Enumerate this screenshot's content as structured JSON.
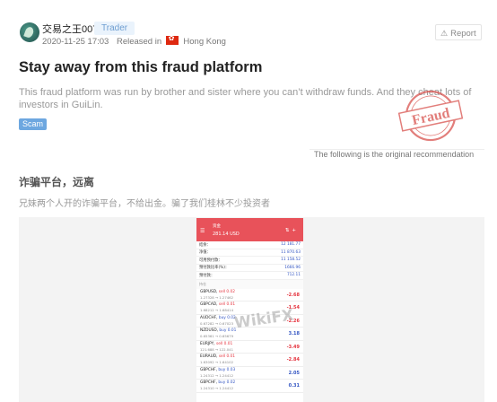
{
  "header": {
    "username": "交易之王007",
    "role": "Trader",
    "datetime": "2020-11-25 17:03",
    "released_label": "Released in",
    "country": "Hong Kong",
    "report_label": "Report"
  },
  "post": {
    "title": "Stay away from this fraud platform",
    "description": "This fraud platform was run by brother and sister where you can’t withdraw funds. And they cheat lots of investors in GuiLin.",
    "tag": "Scam",
    "stamp_text": "Fraud",
    "original_recommendation": "The following is the original recommendation",
    "original_title": "诈骗平台，远离",
    "original_desc": "兄妹两个人开的诈骗平台，不给出金。骗了我们桂林不少投资者"
  },
  "screenshot": {
    "watermark": "WikiFX",
    "menu_icon": "menu-icon",
    "account_label": "资金",
    "balance": "281.14 USD",
    "summary": [
      {
        "label": "结余：",
        "value": "12 181.77"
      },
      {
        "label": "净值：",
        "value": "11 870.63"
      },
      {
        "label": "可用预付款：",
        "value": "11 158.52"
      },
      {
        "label": "预付款比率(%)：",
        "value": "1666.96"
      },
      {
        "label": "预付款：",
        "value": "712.11"
      }
    ],
    "positions_section": "持仓",
    "positions": [
      {
        "symbol": "GBPUSD,",
        "side": "sell 0.02",
        "side_type": "sell",
        "prices": "1.27328 → 1.27462",
        "pl": "-2.68"
      },
      {
        "symbol": "GBPCAD,",
        "side": "sell 0.01",
        "side_type": "sell",
        "prices": "1.68212 → 1.68414",
        "pl": "-1.54"
      },
      {
        "symbol": "AUDCHF,",
        "side": "buy 0.02",
        "side_type": "buy",
        "prices": "0.67282 → 0.67023",
        "pl": "-2.26"
      },
      {
        "symbol": "NZDUSD,",
        "side": "buy 0.01",
        "side_type": "buy",
        "prices": "0.65361 → 0.65679",
        "pl": "3.18"
      },
      {
        "symbol": "EURJPY,",
        "side": "sell 0.01",
        "side_type": "sell",
        "prices": "121.688 → 122.041",
        "pl": "-3.49"
      },
      {
        "symbol": "EURAUD,",
        "side": "sell 0.01",
        "side_type": "sell",
        "prices": "1.63092 → 1.64102",
        "pl": "-2.84"
      },
      {
        "symbol": "GBPCHF,",
        "side": "buy 0.03",
        "side_type": "buy",
        "prices": "1.24312 → 1.24412",
        "pl": "2.05"
      },
      {
        "symbol": "GBPCHF,",
        "side": "buy 0.02",
        "side_type": "buy",
        "prices": "1.24310 → 1.24412",
        "pl": "0.31"
      }
    ]
  }
}
